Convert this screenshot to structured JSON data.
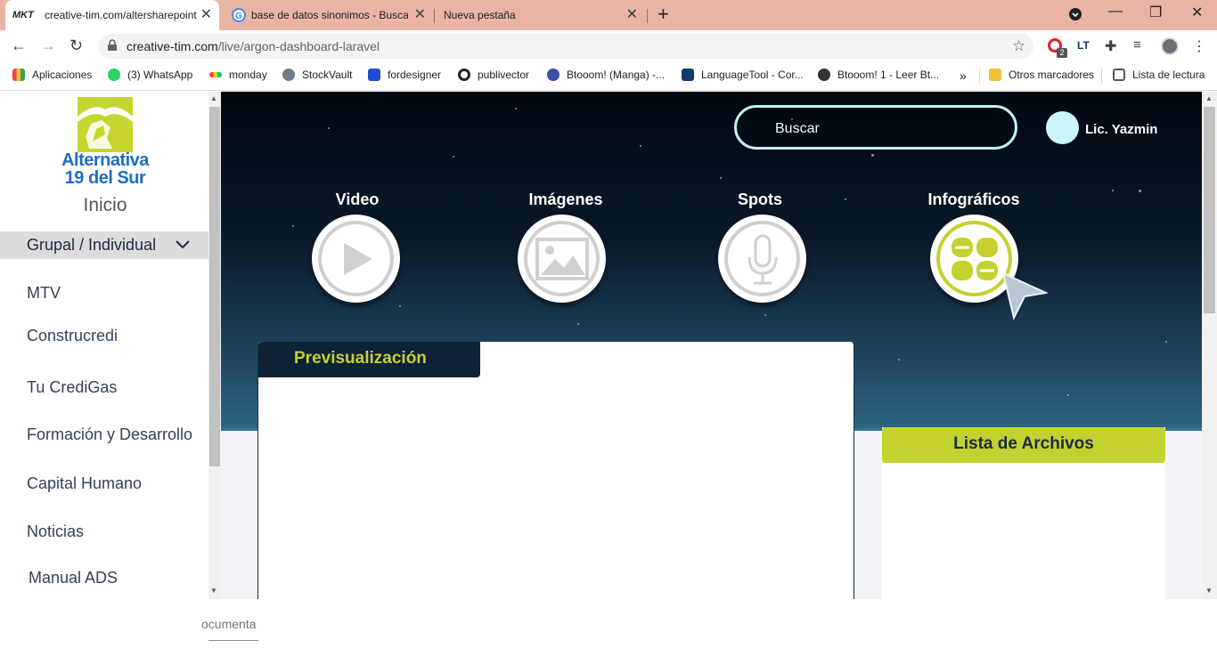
{
  "browser": {
    "tabs": [
      {
        "title": "creative-tim.com/altersharepoint",
        "active": true
      },
      {
        "title": "base de datos sinonimos - Busca",
        "active": false
      },
      {
        "title": "Nueva pestaña",
        "active": false
      }
    ],
    "url_host": "creative-tim.com",
    "url_path": "/live/argon-dashboard-laravel",
    "bookmarks": [
      {
        "label": "Aplicaciones",
        "icon": "apps-grid-icon",
        "color": "#e8453c"
      },
      {
        "label": "(3) WhatsApp",
        "icon": "whatsapp-icon",
        "color": "#25d366"
      },
      {
        "label": "monday",
        "icon": "monday-icon",
        "color": "#ff3d57"
      },
      {
        "label": "StockVault",
        "icon": "stockvault-icon",
        "color": "#6f7c8c"
      },
      {
        "label": "fordesigner",
        "icon": "fordesigner-icon",
        "color": "#1f4fd0"
      },
      {
        "label": "publivector",
        "icon": "publivector-icon",
        "color": "#222222"
      },
      {
        "label": "Btooom! (Manga) -...",
        "icon": "tmo-icon",
        "color": "#3c4ea8"
      },
      {
        "label": "LanguageTool - Cor...",
        "icon": "languagetool-icon",
        "color": "#123a6a"
      },
      {
        "label": "Btooom! 1 - Leer Bt...",
        "icon": "globe-icon",
        "color": "#333333"
      },
      {
        "label": "Otros marcadores",
        "icon": "folder-icon",
        "color": "#f2c232"
      },
      {
        "label": "Lista de lectura",
        "icon": "reading-list-icon",
        "color": "#555555"
      }
    ],
    "extension_badge": "2"
  },
  "sidebar": {
    "logo_line1": "Alternativa",
    "logo_line2": "19 del Sur",
    "title": "Inicio",
    "group_label": "Grupal / Individual",
    "items": [
      {
        "label": "MTV"
      },
      {
        "label": "Construcredi"
      },
      {
        "label": "Tu CrediGas"
      },
      {
        "label": "Formación y Desarrollo"
      },
      {
        "label": "Capital Humano"
      },
      {
        "label": "Noticias"
      },
      {
        "label": "Manual ADS"
      }
    ]
  },
  "header": {
    "search_placeholder": "Buscar",
    "user_name": "Lic. Yazmin"
  },
  "categories": [
    {
      "label": "Video",
      "icon": "play-icon"
    },
    {
      "label": "Imágenes",
      "icon": "image-icon"
    },
    {
      "label": "Spots",
      "icon": "microphone-icon"
    },
    {
      "label": "Infográficos",
      "icon": "infographic-icon"
    }
  ],
  "preview": {
    "title": "Previsualización"
  },
  "files": {
    "title": "Lista de Archivos"
  },
  "footer": {
    "text": "ocumenta"
  },
  "colors": {
    "accent": "#c4d12f",
    "navy": "#0f2236",
    "sky": "#bff2f4"
  }
}
